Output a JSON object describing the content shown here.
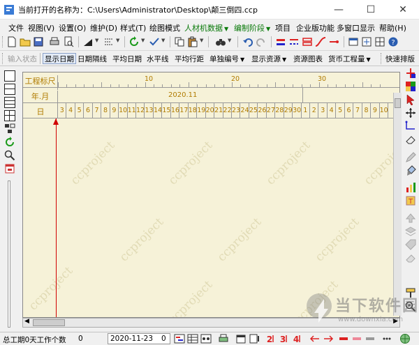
{
  "window": {
    "title": "当前打开的名称为：C:\\Users\\Administrator\\Desktop\\颠三倒四.ccp",
    "minimize_glyph": "—",
    "maximize_glyph": "☐",
    "close_glyph": "✕"
  },
  "menu": {
    "file": "文件",
    "view": "视图(V)",
    "settings": "设置(O)",
    "maintain": "维护(D)",
    "style": "样式(T)",
    "draw_mode": "绘图模式",
    "resource_data": "人材机数据",
    "compile_stage": "编制阶段",
    "project": "项目",
    "enterprise": "企业版功能",
    "multiwindow": "多窗口显示",
    "help": "帮助(H)"
  },
  "toolbar2": {
    "input_status": "输入状态",
    "show_date": "显示日期",
    "date_interval": "日期隔线",
    "avg_date": "平均日期",
    "horizontal_line": "水平线",
    "avg_row_spacing": "平均行距",
    "single_number": "单独编号",
    "show_resource": "显示资源",
    "resource_chart": "资源图表",
    "currency_quantity": "货币工程量",
    "quick_layout": "快速排版"
  },
  "ruler": {
    "row1_label": "工程标尺",
    "row2_label": "年.月",
    "row3_label": "日",
    "ticks": [
      "10",
      "20",
      "30"
    ],
    "month": "2020.11",
    "days": [
      "3",
      "4",
      "5",
      "6",
      "7",
      "8",
      "9",
      "10",
      "11",
      "12",
      "13",
      "14",
      "15",
      "16",
      "17",
      "18",
      "19",
      "20",
      "21",
      "22",
      "23",
      "24",
      "25",
      "26",
      "27",
      "28",
      "29",
      "30",
      "1",
      "2",
      "3",
      "4",
      "5",
      "6",
      "7",
      "8",
      "9",
      "10"
    ]
  },
  "watermark_text": "ccproject",
  "status": {
    "duration_text": "总工期0天工作个数",
    "work_count": "0",
    "date": "2020-11-23",
    "date_extra": "0"
  },
  "site_watermark": {
    "name": "当下软件园",
    "url": "www.downxia.com"
  },
  "colors": {
    "canvas_bg": "#f6f2d8",
    "ruler_text": "#b07b00",
    "today_line": "#d00000",
    "menu_green": "#0a7a0a"
  }
}
